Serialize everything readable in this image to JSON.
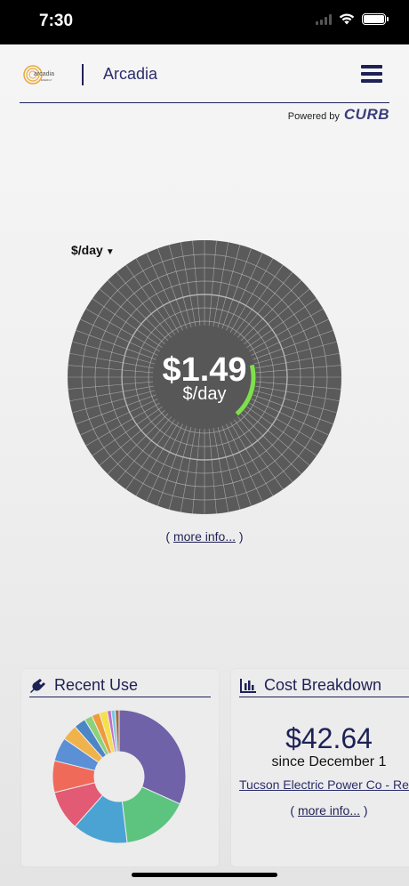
{
  "status_bar": {
    "time": "7:30"
  },
  "header": {
    "logo_text": "arcadia",
    "logo_subtext": "ENERGY",
    "title": "Arcadia"
  },
  "powered": {
    "label": "Powered by",
    "brand": "CURB"
  },
  "gauge": {
    "unit_selector": "$/day",
    "value": "$1.49",
    "unit": "$/day",
    "accent": "#7ee04a",
    "more_info": "more info...",
    "paren_open": "(",
    "paren_close": ")"
  },
  "recent_use": {
    "title": "Recent Use",
    "pie": [
      {
        "value": 33,
        "color": "#6f62a8"
      },
      {
        "value": 17,
        "color": "#5cc47f"
      },
      {
        "value": 14,
        "color": "#4aa3d3"
      },
      {
        "value": 10,
        "color": "#e35a74"
      },
      {
        "value": 8,
        "color": "#f06a5a"
      },
      {
        "value": 6,
        "color": "#5b8fd6"
      },
      {
        "value": 4,
        "color": "#f0b24a"
      },
      {
        "value": 3,
        "color": "#4c86c6"
      },
      {
        "value": 2,
        "color": "#8bd27a"
      },
      {
        "value": 2,
        "color": "#f09a3a"
      },
      {
        "value": 2,
        "color": "#f5e04a"
      },
      {
        "value": 1,
        "color": "#c06dc9"
      },
      {
        "value": 1,
        "color": "#7cc6e6"
      },
      {
        "value": 1,
        "color": "#9e6b4e"
      }
    ]
  },
  "cost": {
    "title": "Cost Breakdown",
    "amount": "$42.64",
    "since": "since December 1",
    "provider": "Tucson Electric Power Co - Res",
    "more_info": "more info...",
    "paren_open": "(",
    "paren_close": ")"
  },
  "colors": {
    "brand_navy": "#1e2156",
    "gauge_dark": "#5a5a5a",
    "logo_gold": "#e8a93a"
  }
}
